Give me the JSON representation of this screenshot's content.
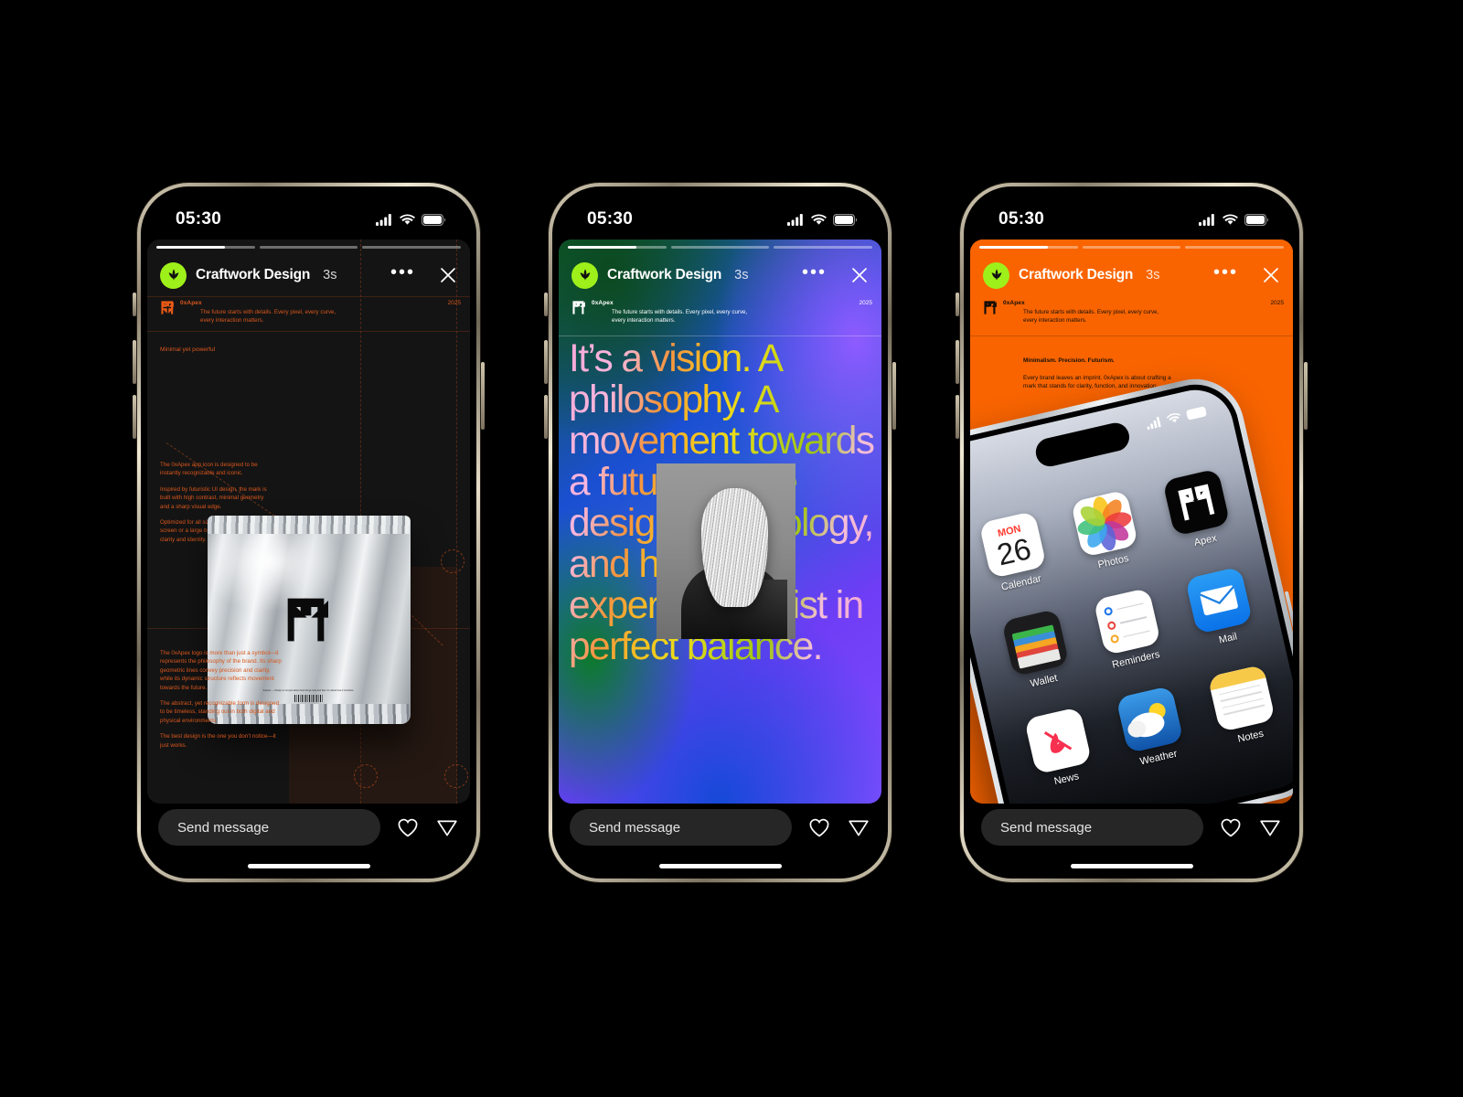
{
  "meta": {
    "canvas_bg": "#000000",
    "device_count": 3
  },
  "status_bar": {
    "time": "05:30",
    "cellular_icon": "cellular-bars-icon",
    "wifi_icon": "wifi-icon",
    "battery_icon": "battery-icon"
  },
  "story_header": {
    "account_name": "Craftwork Design",
    "timestamp": "3s",
    "avatar_icon": "leaf-avatar-icon",
    "avatar_bg": "#9ef01a",
    "more_icon": "more-dots-icon",
    "close_icon": "close-x-icon",
    "progress_segments": [
      70,
      0,
      0
    ]
  },
  "reply_bar": {
    "placeholder": "Send message",
    "like_icon": "heart-icon",
    "share_icon": "send-paper-plane-icon"
  },
  "brand_band": {
    "logo_icon": "0xapex-mark-icon",
    "name": "0xApex",
    "tagline": "The future starts with details. Every pixel, every curve, every interaction matters.",
    "year": "2025"
  },
  "slides": [
    {
      "id": "slide-packaging",
      "background": "#141414",
      "accent": "#d9571d",
      "lead": "Minimal yet powerful",
      "column_a": [
        "The 0xApex app icon is designed to be instantly recognizable and iconic.",
        "Inspired by futuristic UI design, the mark is built with high contrast, minimal geometry and a sharp visual edge.",
        "Optimized for all sizes. Whether on a small screen or a large billboard, the form retains clarity and identity."
      ],
      "column_b": [
        "The 0xApex logo is more than just a symbol—it represents the philosophy of the brand. Its sharp geometric lines convey precision and clarity, while its dynamic structure reflects movement towards the future.",
        "The abstract, yet recognizable form is designed to be timeless, standing out in both digital and physical environments.",
        "The best design is the one you don't notice—it just works."
      ],
      "pouch": {
        "logo_icon": "0xapex-mark-icon",
        "caption": "0xApex — Design is not just about how things look and feel. It's about how it functions.",
        "barcode_icon": "barcode-icon"
      }
    },
    {
      "id": "slide-manifesto",
      "headline": "It’s a vision. A philosophy. A movement towards a future where design, technology, and human experience exist in perfect balance.",
      "portrait_alt": "portrait-long-hair-figure"
    },
    {
      "id": "slide-app-icon",
      "background": "#f96400",
      "heading": "Minimalism. Precision. Futurism.",
      "body": "Every brand leaves an imprint. 0xApex is about crafting a mark that stands for clarity, function, and innovation.",
      "device": {
        "status_icons": [
          "cellular-bars-icon",
          "wifi-icon",
          "battery-icon"
        ],
        "apps": [
          {
            "label": "Calendar",
            "icon": "calendar-app-icon",
            "day_of_week": "MON",
            "day_number": "26"
          },
          {
            "label": "Photos",
            "icon": "photos-app-icon"
          },
          {
            "label": "Apex",
            "icon": "apex-app-icon"
          },
          {
            "label": "Wallet",
            "icon": "wallet-app-icon"
          },
          {
            "label": "Reminders",
            "icon": "reminders-app-icon"
          },
          {
            "label": "Mail",
            "icon": "mail-app-icon"
          },
          {
            "label": "News",
            "icon": "news-app-icon"
          },
          {
            "label": "Weather",
            "icon": "weather-app-icon"
          },
          {
            "label": "Notes",
            "icon": "notes-app-icon"
          }
        ]
      }
    }
  ]
}
